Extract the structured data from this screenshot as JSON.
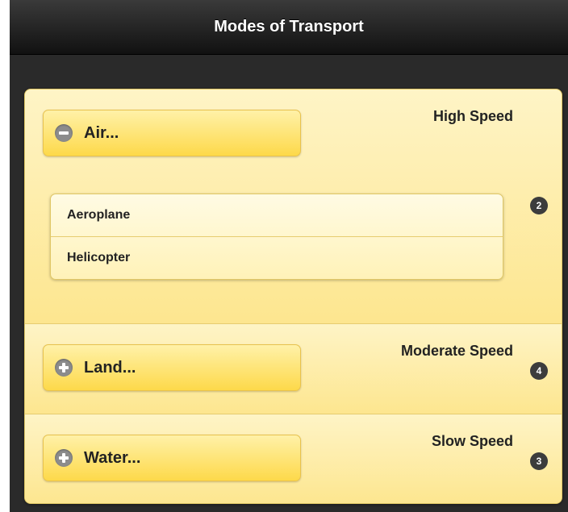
{
  "header": {
    "title": "Modes of Transport"
  },
  "colors": {
    "header_bg": "#1a1a1a",
    "item_bg": "#fde68f",
    "button_bg": "#fdd94a",
    "count_bg": "#3c3c3c"
  },
  "groups": [
    {
      "label": "Air...",
      "aside": "High Speed",
      "count": "2",
      "state": "expanded",
      "icon": "minus-icon",
      "items": [
        "Aeroplane",
        "Helicopter"
      ]
    },
    {
      "label": "Land...",
      "aside": "Moderate Speed",
      "count": "4",
      "state": "collapsed",
      "icon": "plus-icon"
    },
    {
      "label": "Water...",
      "aside": "Slow Speed",
      "count": "3",
      "state": "collapsed",
      "icon": "plus-icon"
    }
  ]
}
